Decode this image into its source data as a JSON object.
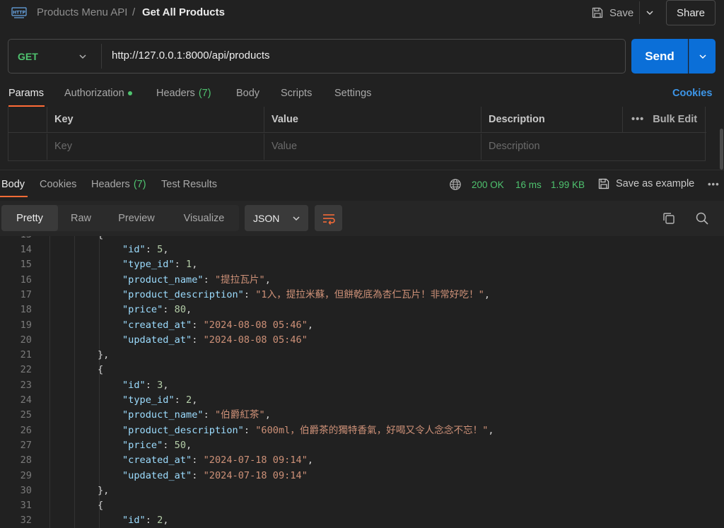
{
  "header": {
    "breadcrumb_parent": "Products Menu API",
    "breadcrumb_sep": "/",
    "breadcrumb_current": "Get All Products",
    "save_label": "Save",
    "share_label": "Share"
  },
  "request": {
    "method": "GET",
    "url": "http://127.0.0.1:8000/api/products",
    "send_label": "Send"
  },
  "request_tabs": {
    "params": "Params",
    "authorization": "Authorization",
    "headers": "Headers",
    "headers_count": "(7)",
    "body": "Body",
    "scripts": "Scripts",
    "settings": "Settings",
    "cookies": "Cookies"
  },
  "params_table": {
    "col_key": "Key",
    "col_value": "Value",
    "col_description": "Description",
    "bulk_edit": "Bulk Edit",
    "placeholder_key": "Key",
    "placeholder_value": "Value",
    "placeholder_description": "Description"
  },
  "response_tabs": {
    "body": "Body",
    "cookies": "Cookies",
    "headers": "Headers",
    "headers_count": "(7)",
    "test_results": "Test Results"
  },
  "response_status": {
    "status": "200 OK",
    "time": "16 ms",
    "size": "1.99 KB",
    "save_example": "Save as example"
  },
  "toolbar": {
    "pretty": "Pretty",
    "raw": "Raw",
    "preview": "Preview",
    "visualize": "Visualize",
    "format": "JSON"
  },
  "code_lines": [
    {
      "n": "14",
      "indent": 2,
      "tokens": [
        [
          "k",
          "\"id\""
        ],
        [
          "p",
          ": "
        ],
        [
          "n",
          "5"
        ],
        [
          "p",
          ","
        ]
      ]
    },
    {
      "n": "15",
      "indent": 2,
      "tokens": [
        [
          "k",
          "\"type_id\""
        ],
        [
          "p",
          ": "
        ],
        [
          "n",
          "1"
        ],
        [
          "p",
          ","
        ]
      ]
    },
    {
      "n": "16",
      "indent": 2,
      "tokens": [
        [
          "k",
          "\"product_name\""
        ],
        [
          "p",
          ": "
        ],
        [
          "s",
          "\"提拉瓦片\""
        ],
        [
          "p",
          ","
        ]
      ]
    },
    {
      "n": "17",
      "indent": 2,
      "tokens": [
        [
          "k",
          "\"product_description\""
        ],
        [
          "p",
          ": "
        ],
        [
          "s",
          "\"1入，提拉米蘇，但餅乾底為杏仁瓦片！非常好吃！\""
        ],
        [
          "p",
          ","
        ]
      ]
    },
    {
      "n": "18",
      "indent": 2,
      "tokens": [
        [
          "k",
          "\"price\""
        ],
        [
          "p",
          ": "
        ],
        [
          "n",
          "80"
        ],
        [
          "p",
          ","
        ]
      ]
    },
    {
      "n": "19",
      "indent": 2,
      "tokens": [
        [
          "k",
          "\"created_at\""
        ],
        [
          "p",
          ": "
        ],
        [
          "s",
          "\"2024-08-08 05:46\""
        ],
        [
          "p",
          ","
        ]
      ]
    },
    {
      "n": "20",
      "indent": 2,
      "tokens": [
        [
          "k",
          "\"updated_at\""
        ],
        [
          "p",
          ": "
        ],
        [
          "s",
          "\"2024-08-08 05:46\""
        ]
      ]
    },
    {
      "n": "21",
      "indent": 1,
      "tokens": [
        [
          "p",
          "},"
        ]
      ]
    },
    {
      "n": "22",
      "indent": 1,
      "tokens": [
        [
          "p",
          "{"
        ]
      ]
    },
    {
      "n": "23",
      "indent": 2,
      "tokens": [
        [
          "k",
          "\"id\""
        ],
        [
          "p",
          ": "
        ],
        [
          "n",
          "3"
        ],
        [
          "p",
          ","
        ]
      ]
    },
    {
      "n": "24",
      "indent": 2,
      "tokens": [
        [
          "k",
          "\"type_id\""
        ],
        [
          "p",
          ": "
        ],
        [
          "n",
          "2"
        ],
        [
          "p",
          ","
        ]
      ]
    },
    {
      "n": "25",
      "indent": 2,
      "tokens": [
        [
          "k",
          "\"product_name\""
        ],
        [
          "p",
          ": "
        ],
        [
          "s",
          "\"伯爵紅茶\""
        ],
        [
          "p",
          ","
        ]
      ]
    },
    {
      "n": "26",
      "indent": 2,
      "tokens": [
        [
          "k",
          "\"product_description\""
        ],
        [
          "p",
          ": "
        ],
        [
          "s",
          "\"600ml，伯爵茶的獨特香氣，好喝又令人念念不忘！\""
        ],
        [
          "p",
          ","
        ]
      ]
    },
    {
      "n": "27",
      "indent": 2,
      "tokens": [
        [
          "k",
          "\"price\""
        ],
        [
          "p",
          ": "
        ],
        [
          "n",
          "50"
        ],
        [
          "p",
          ","
        ]
      ]
    },
    {
      "n": "28",
      "indent": 2,
      "tokens": [
        [
          "k",
          "\"created_at\""
        ],
        [
          "p",
          ": "
        ],
        [
          "s",
          "\"2024-07-18 09:14\""
        ],
        [
          "p",
          ","
        ]
      ]
    },
    {
      "n": "29",
      "indent": 2,
      "tokens": [
        [
          "k",
          "\"updated_at\""
        ],
        [
          "p",
          ": "
        ],
        [
          "s",
          "\"2024-07-18 09:14\""
        ]
      ]
    },
    {
      "n": "30",
      "indent": 1,
      "tokens": [
        [
          "p",
          "},"
        ]
      ]
    },
    {
      "n": "31",
      "indent": 1,
      "tokens": [
        [
          "p",
          "{"
        ]
      ]
    },
    {
      "n": "32",
      "indent": 2,
      "tokens": [
        [
          "k",
          "\"id\""
        ],
        [
          "p",
          ": "
        ],
        [
          "n",
          "2"
        ],
        [
          "p",
          ","
        ]
      ]
    }
  ],
  "colors": {
    "accent_blue": "#0b6fd8",
    "method_green": "#4fc36f",
    "tab_underline": "#ff6c37"
  }
}
